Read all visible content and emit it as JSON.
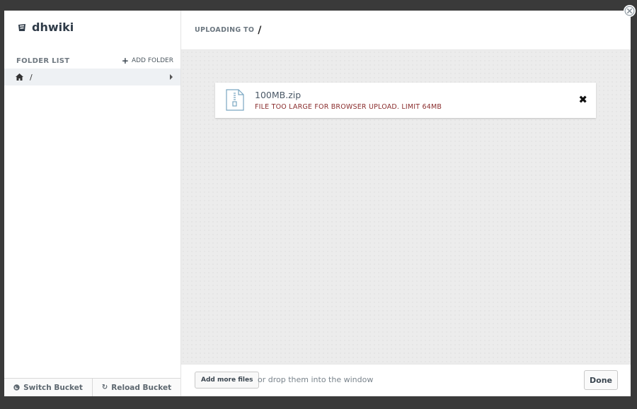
{
  "sidebar": {
    "brand": "dhwiki",
    "folder_list_title": "FOLDER LIST",
    "add_folder_label": "ADD FOLDER",
    "folders": [
      {
        "path": "/"
      }
    ],
    "footer": {
      "switch_bucket_label": "Switch Bucket",
      "reload_bucket_label": "Reload Bucket"
    }
  },
  "header": {
    "uploading_label": "UPLOADING TO",
    "uploading_path": "/"
  },
  "files": [
    {
      "name": "100MB.zip",
      "error": "FILE TOO LARGE FOR BROWSER UPLOAD. LIMIT 64MB"
    }
  ],
  "footer": {
    "add_more_label": "Add more files",
    "drop_hint": "or drop them into the window",
    "done_label": "Done"
  },
  "icons": {
    "brand": "bucket-icon",
    "home": "home-icon",
    "file": "zip-file-icon",
    "remove": "close-icon",
    "close_modal": "close-circle-icon"
  },
  "colors": {
    "error": "#8a2d2d",
    "selected_row": "#eef1f4",
    "body_background": "#ececec"
  }
}
